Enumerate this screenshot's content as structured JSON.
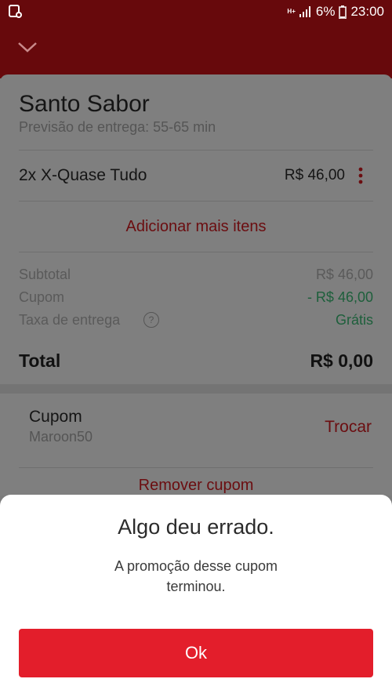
{
  "status_bar": {
    "battery": "6%",
    "time": "23:00",
    "network": "H+"
  },
  "order": {
    "restaurant": "Santo Sabor",
    "eta": "Previsão de entrega: 55-65 min",
    "item": {
      "name": "2x X-Quase Tudo",
      "price": "R$ 46,00"
    },
    "add_more": "Adicionar mais itens",
    "summary": {
      "subtotal_label": "Subtotal",
      "subtotal_value": "R$ 46,00",
      "coupon_label": "Cupom",
      "coupon_value": "- R$ 46,00",
      "delivery_label": "Taxa de entrega",
      "delivery_value": "Grátis",
      "help_icon": "?"
    },
    "total_label": "Total",
    "total_value": "R$ 0,00"
  },
  "coupon": {
    "title": "Cupom",
    "code": "Maroon50",
    "change": "Trocar",
    "remove": "Remover cupom"
  },
  "dialog": {
    "title": "Algo deu errado.",
    "message": "A promoção desse cupom terminou.",
    "ok": "Ok"
  },
  "colors": {
    "header": "#67090c",
    "accent": "#e31e2b",
    "green": "#1d5f3b"
  }
}
